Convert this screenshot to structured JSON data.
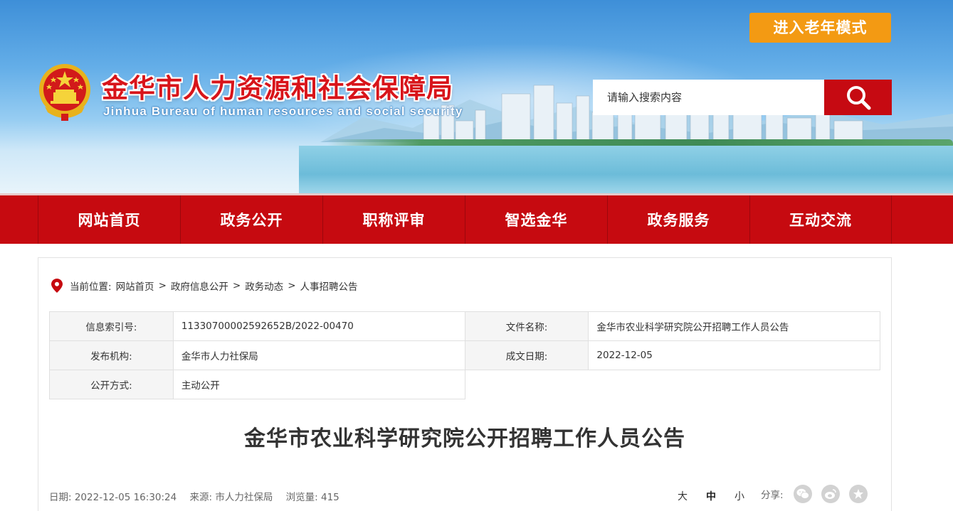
{
  "header": {
    "title": "金华市人力资源和社会保障局",
    "subtitle": "Jinhua Bureau of human resources and social security",
    "elder_mode_label": "进入老年模式",
    "search_placeholder": "请输入搜索内容",
    "search_icon": "magnifier-icon",
    "emblem_icon": "national-emblem"
  },
  "nav": {
    "items": [
      "网站首页",
      "政务公开",
      "职称评审",
      "智选金华",
      "政务服务",
      "互动交流"
    ]
  },
  "breadcrumb": {
    "prefix": "当前位置:",
    "items": [
      "网站首页",
      "政府信息公开",
      "政务动态",
      "人事招聘公告"
    ],
    "separator": ">"
  },
  "meta": {
    "index_label": "信息索引号:",
    "index_value": "11330700002592652B/2022-00470",
    "filename_label": "文件名称:",
    "filename_value": "金华市农业科学研究院公开招聘工作人员公告",
    "publisher_label": "发布机构:",
    "publisher_value": "金华市人力社保局",
    "date_label": "成文日期:",
    "date_value": "2022-12-05",
    "mode_label": "公开方式:",
    "mode_value": "主动公开"
  },
  "article": {
    "title": "金华市农业科学研究院公开招聘工作人员公告",
    "date_text": "日期: 2022-12-05 16:30:24",
    "source_text": "来源: 市人力社保局",
    "views_text": "浏览量: 415"
  },
  "font_size": {
    "large": "大",
    "medium": "中",
    "small": "小",
    "active": "medium"
  },
  "share": {
    "label": "分享:",
    "icons": [
      "wechat-icon",
      "weibo-icon",
      "qzone-icon"
    ]
  },
  "colors": {
    "brand_red": "#c60a10",
    "elder_orange": "#f39a13",
    "title_red": "#d8141a"
  }
}
